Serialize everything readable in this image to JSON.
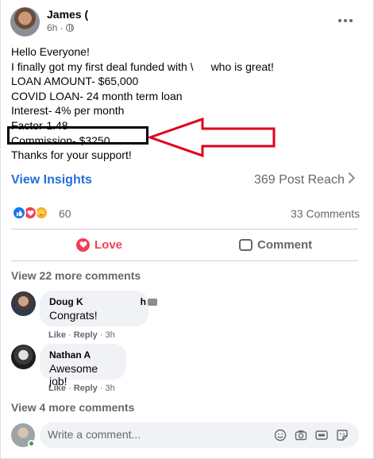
{
  "post": {
    "author": "James (",
    "time": "6h ·",
    "lines": [
      "Hello Everyone!",
      "I finally got my first deal funded with \\",
      "who is great!",
      "LOAN AMOUNT- $65,000",
      "COVID LOAN- 24 month term loan",
      "Interest- 4% per month",
      "Factor-1.48",
      "Commission- $3250"
    ],
    "thanks": "Thanks for your support!"
  },
  "insights": {
    "view_label": "View Insights",
    "reach": "369 Post Reach"
  },
  "reactions": {
    "count": "60",
    "comments": "33 Comments"
  },
  "actions": {
    "love": "Love",
    "comment": "Comment"
  },
  "view_more_top": "View 22 more comments",
  "comments": [
    {
      "name": "Doug K",
      "name_tail": "h",
      "text": "Congrats!",
      "like": "Like",
      "reply": "Reply",
      "time": "3h"
    },
    {
      "name": "Nathan A",
      "text": "Awesome job!",
      "like": "Like",
      "reply": "Reply",
      "time": "3h"
    }
  ],
  "view_more_bottom": "View 4 more comments",
  "composer": {
    "placeholder": "Write a comment..."
  },
  "colors": {
    "link_blue": "#216fdb",
    "love_red": "#f33e58",
    "highlight_arrow": "#e0001a"
  }
}
